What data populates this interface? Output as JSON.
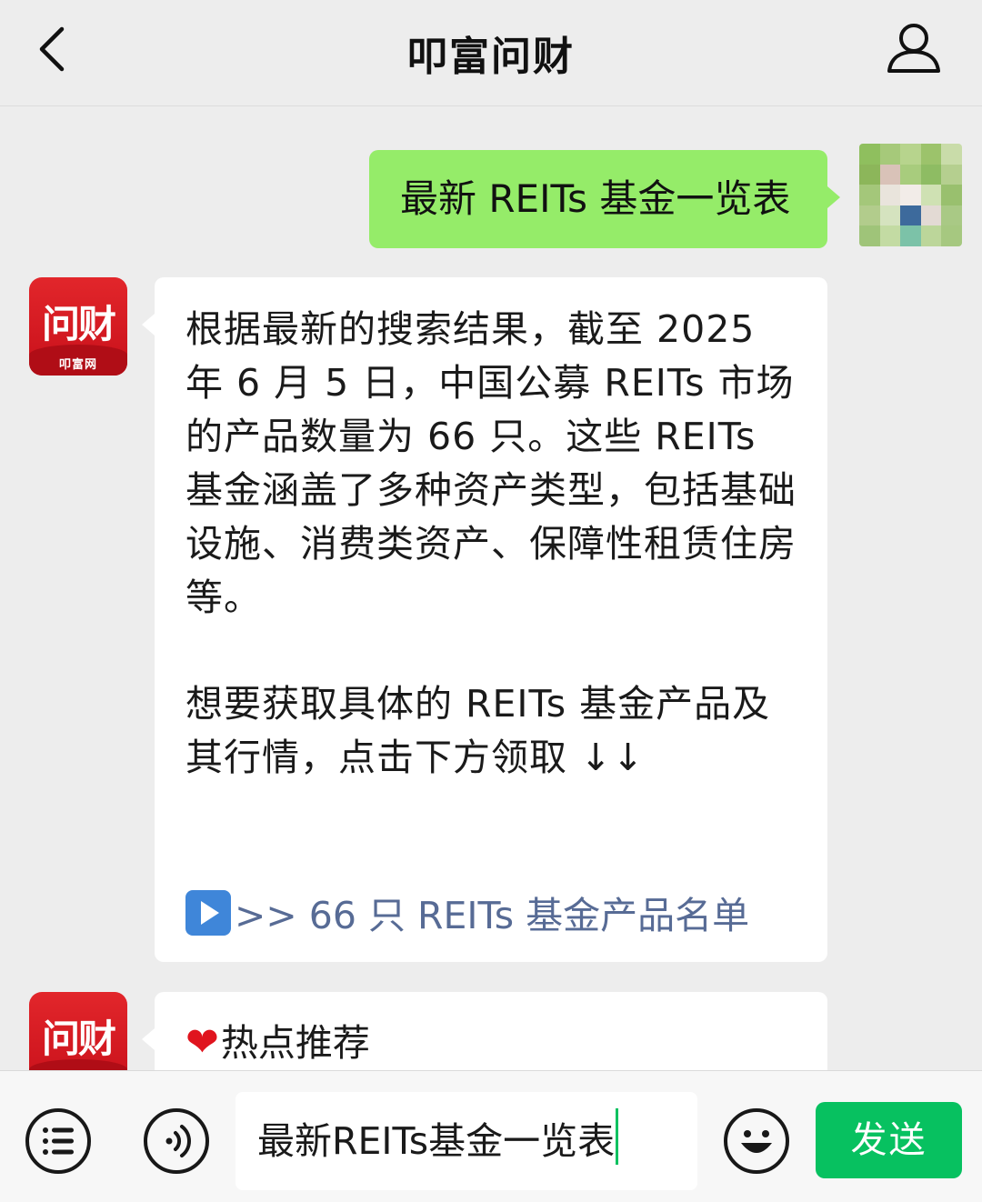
{
  "header": {
    "title": "叩富问财"
  },
  "messages": {
    "user_query": "最新 REITs 基金一览表",
    "bot_reply_para1": "根据最新的搜索结果，截至 2025 年 6 月 5 日，中国公募 REITs 市场的产品数量为 66 只。这些 REITs 基金涵盖了多种资产类型，包括基础设施、消费类资产、保障性租赁住房等。",
    "bot_reply_para2": "想要获取具体的 REITs 基金产品及其行情，点击下方领取 ↓↓",
    "bot_link_text": ">> 66 只 REITs 基金产品名单",
    "hot_title": "热点推荐"
  },
  "bot_avatar": {
    "logo_text": "问财",
    "sub_text": "叩富网"
  },
  "input_bar": {
    "value": "最新REITs基金一览表",
    "send_label": "发送"
  },
  "colors": {
    "user_bubble": "#95ec69",
    "send_button": "#07c160",
    "link": "#576b95",
    "avatar_red": "#d71921"
  },
  "icons": [
    "back-chevron-icon",
    "profile-icon",
    "play-button-icon",
    "heart-icon",
    "menu-list-icon",
    "voice-icon",
    "emoji-icon"
  ]
}
